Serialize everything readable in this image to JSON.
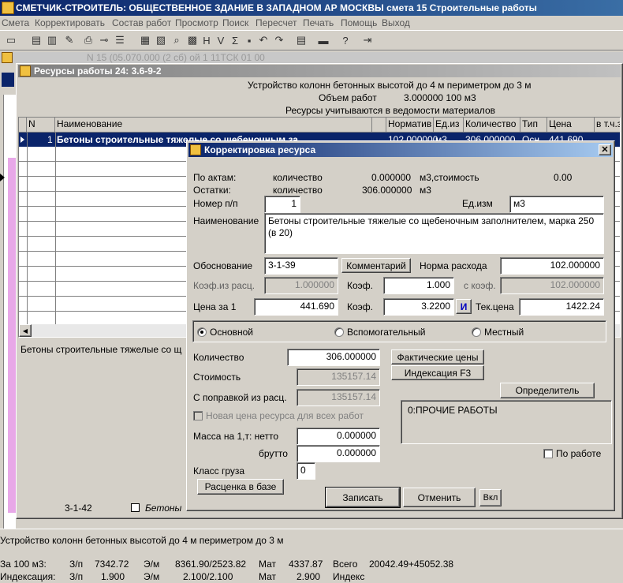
{
  "app": {
    "title": "СМЕТЧИК-СТРОИТЕЛЬ: ОБЩЕСТВЕННОЕ ЗДАНИЕ В ЗАПАДНОМ АР МОСКВЫ смета 15 Строительные работы",
    "menu": [
      "Смета",
      "Корректировать",
      "Состав работ",
      "Просмотр",
      "Поиск",
      "Пересчет",
      "Печать",
      "Помощь",
      "Выход"
    ],
    "bg_window_fragment": "N 15 (05.070.000 (2 сб)          ой          1 11ТСК 01 00",
    "bg_row_code": "3-1-42",
    "bg_row_name": "Бетоны",
    "bottom_title": "Устройство колонн бетонных высотой до 4 м периметром до 3 м",
    "bottom_line1": {
      "label": "За 100 м3:",
      "zp_l": "З/п",
      "zp": "7342.72",
      "em_l": "Э/м",
      "em": "8361.90/2523.82",
      "mat_l": "Мат",
      "mat": "4337.87",
      "total_l": "Всего",
      "total": "20042.49+45052.38"
    },
    "bottom_line2": {
      "label": "Индексация:",
      "zp_l": "З/п",
      "zp": "1.900",
      "em_l": "Э/м",
      "em": "2.100/2.100",
      "mat_l": "Мат",
      "mat": "2.900",
      "total_l": "Индекс"
    }
  },
  "resources": {
    "title": "Ресурсы работы 24: 3.6-9-2",
    "header1": "Устройство колонн бетонных высотой до 4 м периметром до 3 м",
    "header2_label": "Объем работ",
    "header2_value": "3.000000 100 м3",
    "header3": "Ресурсы учитываются в ведомости материалов",
    "columns": [
      "N",
      "Наименование",
      "Норматив",
      "Ед.из",
      "Количество",
      "Тип",
      "Цена",
      "в т.ч.з"
    ],
    "row1": {
      "n": "1",
      "name": "Бетоны строительные тяжелые со щебеночным за",
      "norm": "102.000000",
      "unit": "м3",
      "qty": "306.000000",
      "type": "Осн",
      "price": "441.690"
    },
    "status": "Бетоны строительные тяжелые со щ"
  },
  "dialog": {
    "title": "Корректировка ресурса",
    "po_aktam": {
      "label": "По актам:",
      "q_label": "количество",
      "q": "0.000000",
      "unit": "м3,стоимость",
      "cost": "0.00"
    },
    "ostatki": {
      "label": "Остатки:",
      "q_label": "количество",
      "q": "306.000000",
      "unit": "м3"
    },
    "nomer_label": "Номер п/п",
    "nomer": "1",
    "edizm_label": "Ед.изм",
    "edizm": "м3",
    "name_label": "Наименование",
    "name": "Бетоны строительные тяжелые со щебеночным заполнителем, марка 250 (в 20)",
    "obosn_label": "Обоснование",
    "obosn": "3-1-39",
    "comment_btn": "Комментарий",
    "norma_label": "Норма расхода",
    "norma": "102.000000",
    "koefiz_label": "Коэф.из расц.",
    "koefiz": "1.000000",
    "koef_label": "Коэф.",
    "koef1": "1.000",
    "skoef_label": "с коэф.",
    "skoef": "102.000000",
    "cena_label": "Цена за 1",
    "cena": "441.690",
    "koef2": "3.2200",
    "i_btn": "И",
    "tekcena_label": "Тек.цена",
    "tekcena": "1422.24",
    "radio_main": "Основной",
    "radio_aux": "Вспомогательный",
    "radio_local": "Местный",
    "qty_label": "Количество",
    "qty": "306.000000",
    "fact_btn": "Фактические цены",
    "index_btn": "Индексация F3",
    "cost_label": "Стоимость",
    "cost": "135157.14",
    "corr_label": "С поправкой из расц.",
    "corr": "135157.14",
    "opred_btn": "Определитель",
    "newprice_label": "Новая цена ресурса для всех работ",
    "opred_text": "0:ПРОЧИЕ РАБОТЫ",
    "mass_label": "Масса на 1,т: нетто",
    "mass_net": "0.000000",
    "brutto_label": "брутто",
    "mass_gross": "0.000000",
    "po_rabote_label": "По работе",
    "klass_label": "Класс груза",
    "klass": "0",
    "rascenka_btn": "Расценка в базе",
    "save_btn": "Записать",
    "cancel_btn": "Отменить",
    "vkl_btn": "Вкл"
  }
}
